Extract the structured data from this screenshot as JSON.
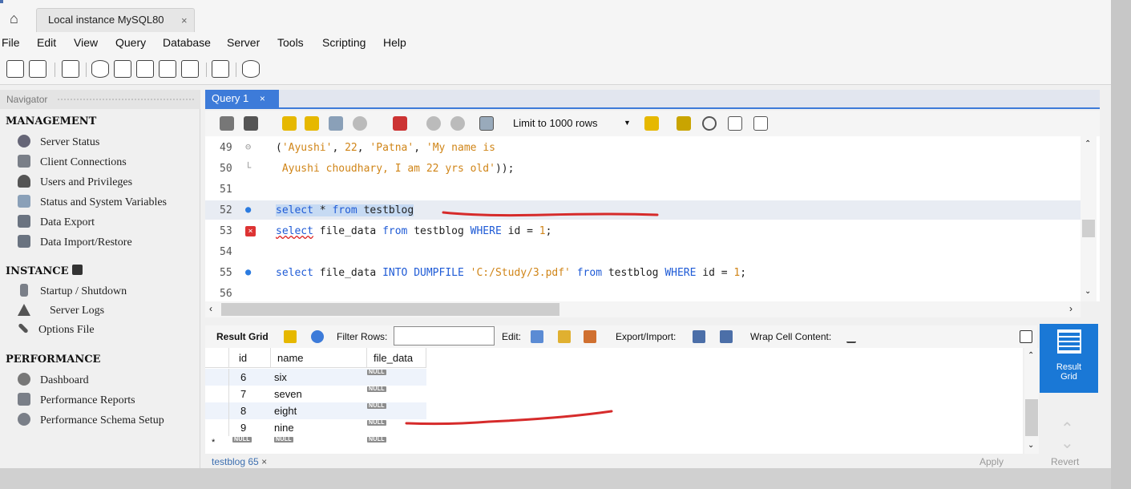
{
  "window": {
    "connection_tab": "Local instance MySQL80",
    "connection_tab_close": "×"
  },
  "menu": [
    "File",
    "Edit",
    "View",
    "Query",
    "Database",
    "Server",
    "Tools",
    "Scripting",
    "Help"
  ],
  "navigator": {
    "title": "Navigator",
    "sections": {
      "management": "MANAGEMENT",
      "instance": "INSTANCE",
      "performance": "PERFORMANCE"
    },
    "management_items": [
      "Server Status",
      "Client Connections",
      "Users and Privileges",
      "Status and System Variables",
      "Data Export",
      "Data Import/Restore"
    ],
    "instance_items": [
      "Startup / Shutdown",
      "Server Logs",
      "Options File"
    ],
    "performance_items": [
      "Dashboard",
      "Performance Reports",
      "Performance Schema Setup"
    ]
  },
  "query_tab": {
    "label": "Query 1",
    "close": "×"
  },
  "editor_toolbar": {
    "limit_label": "Limit to 1000 rows"
  },
  "editor": {
    "lines": [
      {
        "n": "49",
        "parts": [
          [
            "",
            "("
          ],
          [
            "str",
            "'Ayushi'"
          ],
          [
            "",
            ", "
          ],
          [
            "num",
            "22"
          ],
          [
            "",
            ", "
          ],
          [
            "str",
            "'Patna'"
          ],
          [
            "",
            ", "
          ],
          [
            "str",
            "'My name is"
          ]
        ]
      },
      {
        "n": "50",
        "parts": [
          [
            "str",
            " Ayushi choudhary, I am 22 yrs old'"
          ],
          [
            "",
            "));"
          ]
        ]
      },
      {
        "n": "51",
        "parts": []
      },
      {
        "n": "52",
        "parts": [
          [
            "kw",
            "select"
          ],
          [
            "",
            " * "
          ],
          [
            "kw",
            "from"
          ],
          [
            "",
            " testblog"
          ]
        ]
      },
      {
        "n": "53",
        "parts": [
          [
            "kw",
            "select"
          ],
          [
            "",
            " file_data "
          ],
          [
            "kw",
            "from"
          ],
          [
            "",
            " testblog "
          ],
          [
            "kw",
            "WHERE"
          ],
          [
            "",
            " id = "
          ],
          [
            "num",
            "1"
          ],
          [
            "",
            ";"
          ]
        ]
      },
      {
        "n": "54",
        "parts": []
      },
      {
        "n": "55",
        "parts": [
          [
            "kw",
            "select"
          ],
          [
            "",
            " file_data "
          ],
          [
            "kw",
            "INTO"
          ],
          [
            "",
            " "
          ],
          [
            "kw",
            "DUMPFILE"
          ],
          [
            "",
            " "
          ],
          [
            "str",
            "'C:/Study/3.pdf'"
          ],
          [
            "",
            " "
          ],
          [
            "kw",
            "from"
          ],
          [
            "",
            " testblog "
          ],
          [
            "kw",
            "WHERE"
          ],
          [
            "",
            " id = "
          ],
          [
            "num",
            "1"
          ],
          [
            "",
            ";"
          ]
        ]
      },
      {
        "n": "56",
        "parts": []
      }
    ]
  },
  "result_toolbar": {
    "result_grid": "Result Grid",
    "filter_rows": "Filter Rows:",
    "edit": "Edit:",
    "export_import": "Export/Import:",
    "wrap": "Wrap Cell Content:"
  },
  "grid": {
    "columns": [
      "id",
      "name",
      "file_data"
    ],
    "rows": [
      [
        "6",
        "six",
        "NULL"
      ],
      [
        "7",
        "seven",
        "NULL"
      ],
      [
        "8",
        "eight",
        "NULL"
      ],
      [
        "9",
        "nine",
        "NULL"
      ]
    ],
    "new_row_marker": "*",
    "null_label": "NULL"
  },
  "side_panel": {
    "label_line1": "Result",
    "label_line2": "Grid"
  },
  "bottom": {
    "result_tab": "testblog 65",
    "result_tab_close": "×",
    "apply": "Apply",
    "revert": "Revert"
  },
  "colors": {
    "accent": "#3d7bd9",
    "annotation": "#d62b2b",
    "keyword": "#1f5bd6",
    "string": "#d08518"
  }
}
